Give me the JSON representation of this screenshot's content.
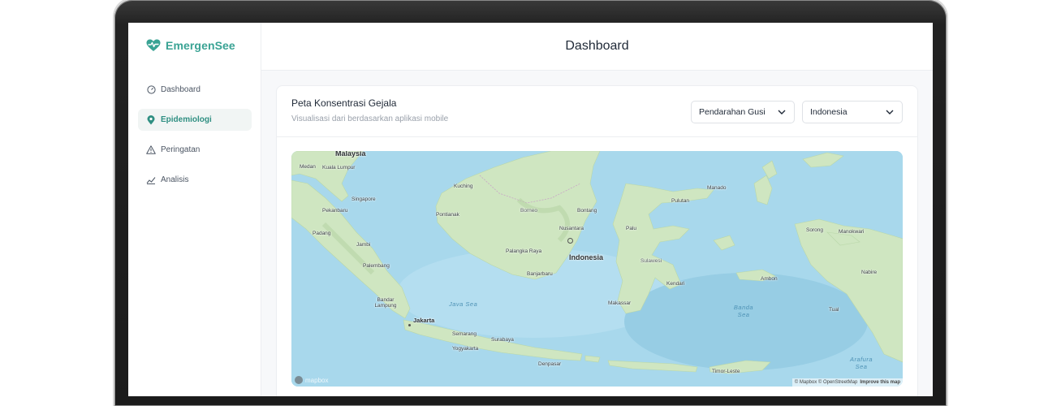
{
  "app": {
    "brand_name": "EmergenSee",
    "brand_color": "#3aa394"
  },
  "sidebar": {
    "items": [
      {
        "label": "Dashboard",
        "icon": "gauge-icon",
        "active": false
      },
      {
        "label": "Epidemiologi",
        "icon": "map-pin-icon",
        "active": true
      },
      {
        "label": "Peringatan",
        "icon": "warning-triangle-icon",
        "active": false
      },
      {
        "label": "Analisis",
        "icon": "chart-line-icon",
        "active": false
      }
    ]
  },
  "header": {
    "title": "Dashboard"
  },
  "card": {
    "title": "Peta Konsentrasi Gejala",
    "subtitle": "Visualisasi dari berdasarkan aplikasi mobile",
    "symptom_select": {
      "value": "Pendarahan Gusi"
    },
    "region_select": {
      "value": "Indonesia"
    }
  },
  "map": {
    "labels": {
      "malaysia": "Malaysia",
      "medan": "Medan",
      "kuala_lumpur": "Kuala Lumpur",
      "singapore": "Singapore",
      "pekanbaru": "Pekanbaru",
      "padang": "Padang",
      "jambi": "Jambi",
      "palembang": "Palembang",
      "bandar_lampung": "Bandar Lampung",
      "jakarta": "Jakarta",
      "semarang": "Semarang",
      "surabaya": "Surabaya",
      "yogyakarta": "Yogyakarta",
      "denpasar": "Denpasar",
      "kuching": "Kuching",
      "pontianak": "Pontianak",
      "borneo": "Borneo",
      "bontang": "Bontang",
      "nusantara": "Nusantara",
      "palangka_raya": "Palangka Raya",
      "banjarbaru": "Banjarbaru",
      "indonesia": "Indonesia",
      "palu": "Palu",
      "sulawesi": "Sulawesi",
      "makassar": "Makassar",
      "kendari": "Kendari",
      "manado": "Manado",
      "pulutan": "Pulutan",
      "ambon": "Ambon",
      "sorong": "Sorong",
      "manokwari": "Manokwari",
      "nabire": "Nabire",
      "tual": "Tual",
      "timor_leste": "Timor-Leste",
      "java_sea": "Java Sea",
      "banda_sea": "Banda Sea",
      "arafura_sea": "Arafura Sea"
    },
    "logo_text": "mapbox",
    "attribution": "© Mapbox © OpenStreetMap",
    "improve_link": "Improve this map",
    "land_color": "#cfe6c1",
    "water_color": "#a8d8ec"
  }
}
